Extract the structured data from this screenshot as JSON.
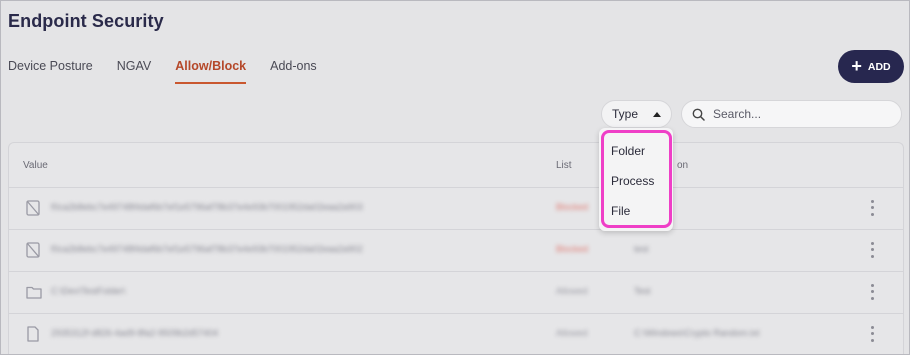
{
  "page": {
    "title": "Endpoint Security"
  },
  "tabs": [
    {
      "label": "Device Posture",
      "active": false
    },
    {
      "label": "NGAV",
      "active": false
    },
    {
      "label": "Allow/Block",
      "active": true
    },
    {
      "label": "Add-ons",
      "active": false
    }
  ],
  "add_button": {
    "label": "ADD",
    "icon": "plus-icon"
  },
  "filters": {
    "type_label": "Type",
    "type_options": [
      "Folder",
      "Process",
      "File"
    ],
    "search_placeholder": "Search..."
  },
  "table": {
    "columns": {
      "value": "Value",
      "list": "List",
      "description_fragment": "on"
    },
    "rows": [
      {
        "icon": "blocked-icon",
        "value": "f0ca2b8ebc7e49748f4daf6b7ef1e5796af78b37e4e93b7001952da02eaa2a903",
        "list": "Blocked",
        "description": ""
      },
      {
        "icon": "blocked-icon",
        "value": "f0ca2b8ebc7e49748f4daf6b7ef1e5796af78b37e4e93b7001952da02eaa2a902",
        "list": "Blocked",
        "description": "test"
      },
      {
        "icon": "folder-icon",
        "value": "C:\\Dev\\TestFolder\\",
        "list": "Allowed",
        "description": "Test"
      },
      {
        "icon": "file-icon",
        "value": "2935312f-d826-4ad9-8fa2-9509b2d57404",
        "list": "Allowed",
        "description": "C:\\Windows\\Crypto Random.txt"
      }
    ]
  },
  "colors": {
    "accent": "#c9572f",
    "add_button": "#27274f",
    "highlight": "#ef3fc7",
    "blocked": "#e07a72",
    "allowed": "#9a9aa3"
  }
}
